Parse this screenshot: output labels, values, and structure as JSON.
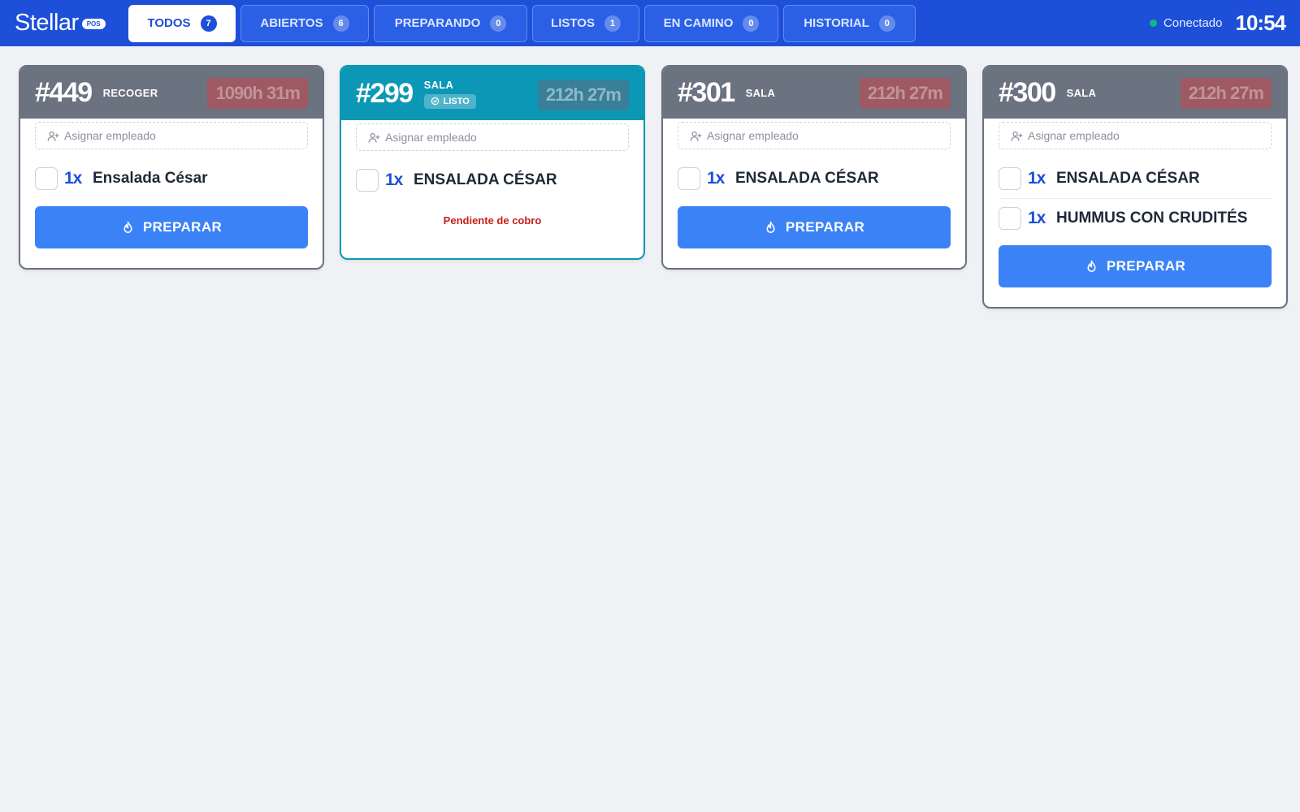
{
  "brand": {
    "name": "Stellar",
    "badge": "POS"
  },
  "tabs": [
    {
      "label": "TODOS",
      "count": "7",
      "active": true
    },
    {
      "label": "ABIERTOS",
      "count": "6"
    },
    {
      "label": "PREPARANDO",
      "count": "0"
    },
    {
      "label": "LISTOS",
      "count": "1"
    },
    {
      "label": "EN CAMINO",
      "count": "0"
    },
    {
      "label": "HISTORIAL",
      "count": "0"
    }
  ],
  "status": {
    "label": "Conectado",
    "color": "#10b981"
  },
  "clock": "10:54",
  "colors": {
    "header": "#1d4fd8",
    "primary": "#3b82f6",
    "ready": "#0c97b6",
    "pending": "#c81e1e"
  },
  "orders": [
    {
      "number": "#449",
      "type": "RECOGER",
      "timer": "1090h 31m",
      "assign_placeholder": "Asignar empleado",
      "items": [
        {
          "qty": "1x",
          "name": "Ensalada César"
        }
      ],
      "action_label": "PREPARAR"
    },
    {
      "number": "#299",
      "type": "SALA",
      "status_badge": "LISTO",
      "timer": "212h 27m",
      "assign_placeholder": "Asignar empleado",
      "items": [
        {
          "qty": "1x",
          "name": "ENSALADA CÉSAR"
        }
      ],
      "note": "Pendiente de cobro"
    },
    {
      "number": "#301",
      "type": "SALA",
      "timer": "212h 27m",
      "assign_placeholder": "Asignar empleado",
      "items": [
        {
          "qty": "1x",
          "name": "ENSALADA CÉSAR"
        }
      ],
      "action_label": "PREPARAR"
    },
    {
      "number": "#300",
      "type": "SALA",
      "timer": "212h 27m",
      "assign_placeholder": "Asignar empleado",
      "items": [
        {
          "qty": "1x",
          "name": "ENSALADA CÉSAR"
        },
        {
          "qty": "1x",
          "name": "HUMMUS CON CRUDITÉS"
        }
      ],
      "action_label": "PREPARAR"
    }
  ]
}
